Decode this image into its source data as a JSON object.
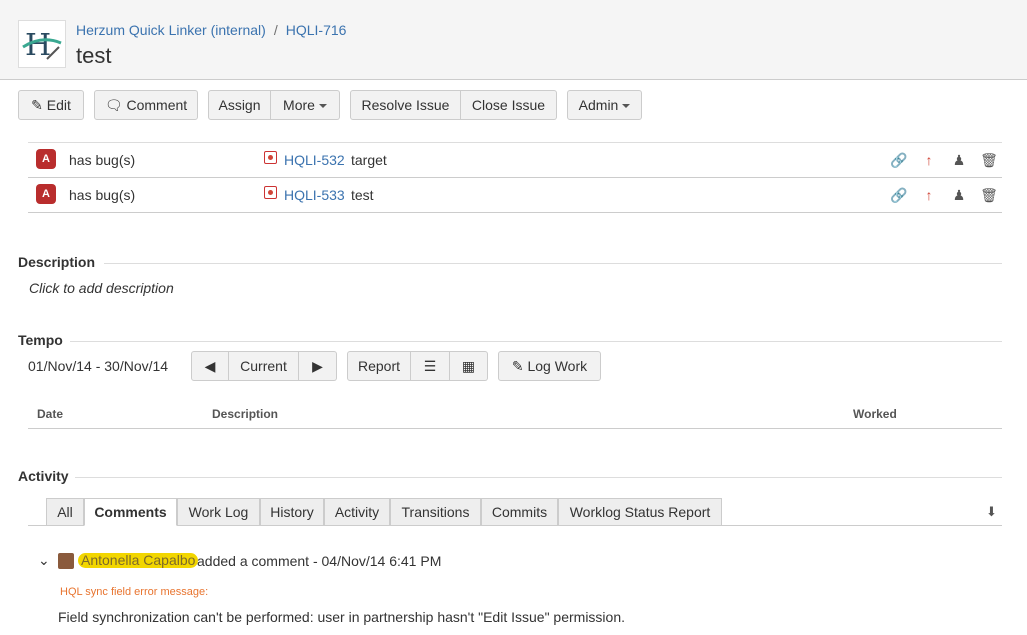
{
  "header": {
    "project": "Herzum Quick Linker (internal)",
    "separator": "/",
    "issue_key": "HQLI-716",
    "summary": "test"
  },
  "toolbar": {
    "edit": "Edit",
    "comment": "Comment",
    "assign": "Assign",
    "more": "More",
    "resolve": "Resolve Issue",
    "close": "Close Issue",
    "admin": "Admin"
  },
  "links": [
    {
      "relation": "has bug(s)",
      "key": "HQLI-532",
      "title": "target",
      "type_icon": "A"
    },
    {
      "relation": "has bug(s)",
      "key": "HQLI-533",
      "title": "test",
      "type_icon": "A"
    }
  ],
  "description": {
    "heading": "Description",
    "placeholder": "Click to add description"
  },
  "tempo": {
    "heading": "Tempo",
    "period": "01/Nov/14 - 30/Nov/14",
    "current": "Current",
    "report": "Report",
    "log_work": "Log Work",
    "columns": [
      "Date",
      "Description",
      "Worked"
    ]
  },
  "activity": {
    "heading": "Activity",
    "tabs": [
      "All",
      "Comments",
      "Work Log",
      "History",
      "Activity",
      "Transitions",
      "Commits",
      "Worklog Status Report"
    ],
    "active_tab": "Comments",
    "comment": {
      "author": "Antonella Capalbo",
      "meta": "added a comment - 04/Nov/14 6:41 PM",
      "error_title": "HQL sync field error message:",
      "body": "Field synchronization can't be performed: user in partnership hasn't \"Edit Issue\" permission."
    }
  },
  "colors": {
    "link": "#3b73af",
    "bug": "#d04437",
    "error": "#e8742f",
    "highlight": "#f2d600"
  }
}
